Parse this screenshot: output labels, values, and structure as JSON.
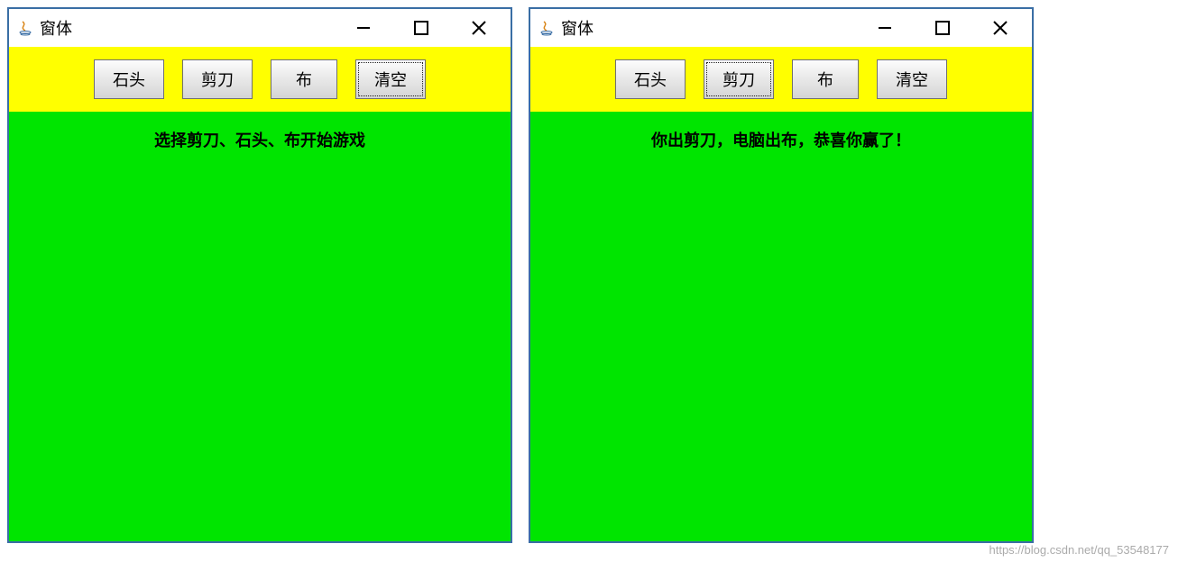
{
  "windows": [
    {
      "title": "窗体",
      "buttons": {
        "rock": "石头",
        "scissors": "剪刀",
        "paper": "布",
        "clear": "清空"
      },
      "focused_button": "clear",
      "message": "选择剪刀、石头、布开始游戏"
    },
    {
      "title": "窗体",
      "buttons": {
        "rock": "石头",
        "scissors": "剪刀",
        "paper": "布",
        "clear": "清空"
      },
      "focused_button": "scissors",
      "message": "你出剪刀，电脑出布，恭喜你赢了！"
    }
  ],
  "watermark": "https://blog.csdn.net/qq_53548177"
}
